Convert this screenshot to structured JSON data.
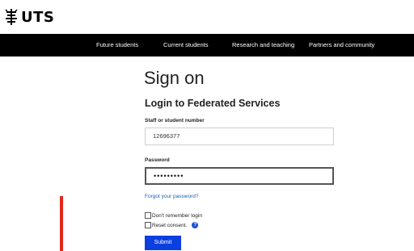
{
  "brand": {
    "name": "UTS"
  },
  "nav": {
    "items": [
      "Future students",
      "Current students",
      "Research and teaching",
      "Partners and community"
    ]
  },
  "page": {
    "title": "Sign on",
    "subtitle": "Login to Federated Services"
  },
  "form": {
    "username": {
      "label": "Staff or student number",
      "value": "12696377"
    },
    "password": {
      "label": "Password",
      "value": "•••••••••"
    },
    "forgot_link": "Forgot your password?",
    "remember_label": "Don't remember login",
    "reset_label": "Reset consent.",
    "help_icon_glyph": "?",
    "submit_label": "Submit"
  },
  "colors": {
    "nav_bg": "#000000",
    "link": "#1a5fb4",
    "submit_bg": "#0b3fe0",
    "annotation_red": "#e3261b"
  }
}
